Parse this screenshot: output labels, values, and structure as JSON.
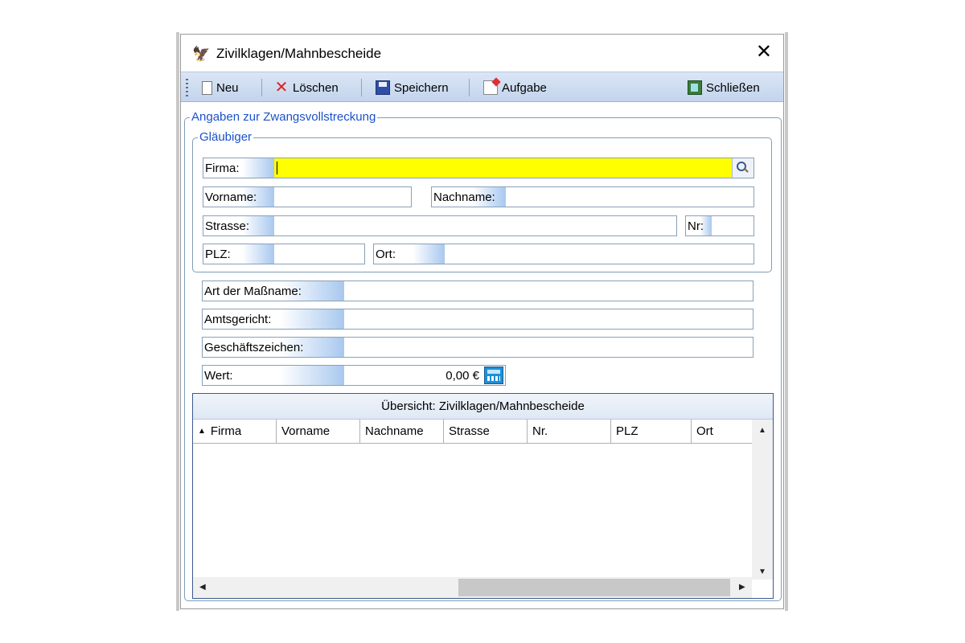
{
  "window": {
    "title": "Zivilklagen/Mahnbescheide",
    "app_icon": "eagle-icon",
    "close_glyph": "✕"
  },
  "toolbar": {
    "new_label": "Neu",
    "delete_label": "Löschen",
    "save_label": "Speichern",
    "task_label": "Aufgabe",
    "close_label": "Schließen"
  },
  "section": {
    "legend": "Angaben zur Zwangsvollstreckung",
    "creditor": {
      "legend": "Gläubiger",
      "firma_label": "Firma:",
      "firma_value": "",
      "vorname_label": "Vorname:",
      "vorname_value": "",
      "nachname_label": "Nachname:",
      "nachname_value": "",
      "strasse_label": "Strasse:",
      "strasse_value": "",
      "nr_label": "Nr:",
      "nr_value": "",
      "plz_label": "PLZ:",
      "plz_value": "",
      "ort_label": "Ort:",
      "ort_value": ""
    },
    "art_label": "Art der Maßname:",
    "art_value": "",
    "amtsgericht_label": "Amtsgericht:",
    "amtsgericht_value": "",
    "geschaeftszeichen_label": "Geschäftszeichen:",
    "geschaeftszeichen_value": "",
    "wert_label": "Wert:",
    "wert_value": "0,00 €"
  },
  "overview": {
    "title": "Übersicht: Zivilklagen/Mahnbescheide",
    "sort_glyph": "▲",
    "columns": [
      "Firma",
      "Vorname",
      "Nachname",
      "Strasse",
      "Nr.",
      "PLZ",
      "Ort"
    ],
    "rows": []
  },
  "colors": {
    "accent_blue": "#1a52c6",
    "required_field": "#ffff00",
    "toolbar": "#c2d4ec"
  }
}
